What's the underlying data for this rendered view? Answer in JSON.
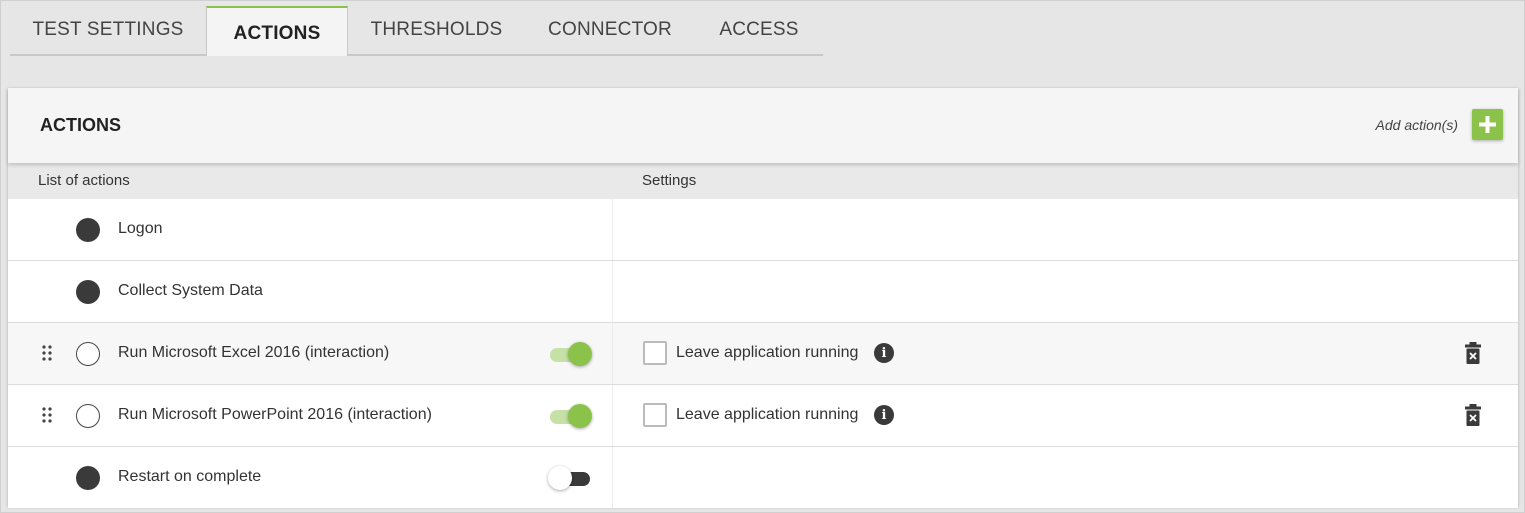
{
  "tabs": [
    {
      "label": "TEST SETTINGS",
      "active": false
    },
    {
      "label": "ACTIONS",
      "active": true
    },
    {
      "label": "THRESHOLDS",
      "active": false
    },
    {
      "label": "CONNECTOR",
      "active": false
    },
    {
      "label": "ACCESS",
      "active": false
    }
  ],
  "panel": {
    "title": "ACTIONS",
    "add_label": "Add action(s)",
    "add_icon": "plus-icon"
  },
  "columns": {
    "list": "List of actions",
    "settings": "Settings"
  },
  "actions": [
    {
      "name": "Logon",
      "node": "filled",
      "draggable": false,
      "toggle": null,
      "setting": null,
      "deletable": false
    },
    {
      "name": "Collect System Data",
      "node": "filled",
      "draggable": false,
      "toggle": null,
      "setting": null,
      "deletable": false
    },
    {
      "name": "Run Microsoft Excel 2016 (interaction)",
      "node": "hollow",
      "draggable": true,
      "toggle": "on",
      "setting": {
        "label": "Leave application running",
        "checked": false
      },
      "deletable": true
    },
    {
      "name": "Run Microsoft PowerPoint 2016 (interaction)",
      "node": "hollow",
      "draggable": true,
      "toggle": "on",
      "setting": {
        "label": "Leave application running",
        "checked": false
      },
      "deletable": true
    },
    {
      "name": "Restart on complete",
      "node": "filled",
      "draggable": false,
      "toggle": "off",
      "setting": null,
      "deletable": false
    }
  ],
  "colors": {
    "accent": "#8bc34a",
    "accent_light": "#c5e1a5",
    "dark": "#3a3a3a"
  }
}
